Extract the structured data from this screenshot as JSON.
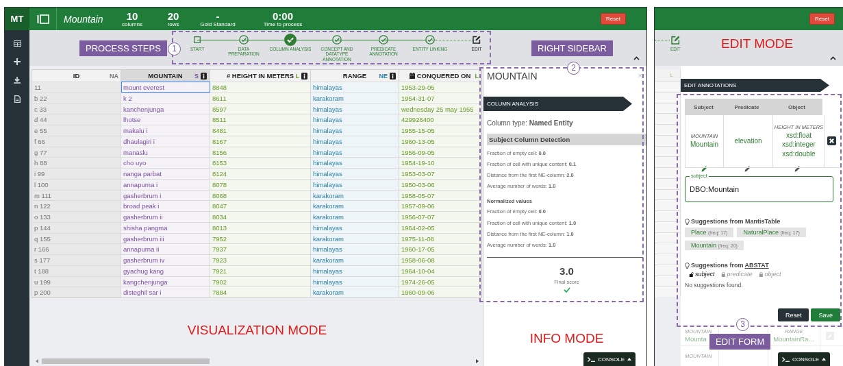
{
  "main_screen": {
    "header": {
      "logo": "MT",
      "table_name": "Mountain",
      "stats": [
        {
          "value": "10",
          "label": "columns"
        },
        {
          "value": "20",
          "label": "rows"
        },
        {
          "value": "-",
          "label": "Gold Standard"
        },
        {
          "value": "0:00",
          "label": "Time to process"
        }
      ],
      "reset_button": "Reset"
    },
    "process_steps": [
      {
        "label": "START",
        "kind": "start",
        "selected": false
      },
      {
        "label": "DATA PREPARATION",
        "kind": "check",
        "selected": false
      },
      {
        "label": "COLUMN ANALYSIS",
        "kind": "check",
        "selected": true
      },
      {
        "label": "CONCEPT AND DATATYPE ANNOTATION",
        "kind": "check",
        "selected": false
      },
      {
        "label": "PREDICATE ANNOTATION",
        "kind": "check",
        "selected": false
      },
      {
        "label": "ENTITY LINKING",
        "kind": "check",
        "selected": false
      },
      {
        "label": "EDIT",
        "kind": "edit",
        "selected": false
      }
    ],
    "table": {
      "columns": [
        {
          "name": "ID",
          "tag": "NA",
          "color": "#757575",
          "selected": false,
          "info": false,
          "kind": "text"
        },
        {
          "name": "MOUNTAIN",
          "tag": "S",
          "color": "#7b4fa0",
          "selected": true,
          "info": true,
          "kind": "text"
        },
        {
          "name": "# HEIGHT IN METERS",
          "tag": "L",
          "color": "#6a9a2a",
          "selected": false,
          "info": true,
          "kind": "text"
        },
        {
          "name": "RANGE",
          "tag": "NE",
          "color": "#2a7fa8",
          "selected": false,
          "info": true,
          "kind": "text"
        },
        {
          "name": "CONQUERED ON",
          "tag": "L",
          "color": "#6a9a2a",
          "selected": false,
          "info": false,
          "kind": "date"
        }
      ],
      "rows": [
        {
          "cells": [
            "11",
            "mount everest",
            "8848",
            "himalayas",
            "1953-29-05"
          ],
          "selected": true
        },
        {
          "cells": [
            "b 22",
            "k 2",
            "8611",
            "karakoram",
            "1954-31-07"
          ],
          "selected": false
        },
        {
          "cells": [
            "c 33",
            "kanchenjunga",
            "8597",
            "himalayas",
            "wednesday 25 may 1955"
          ],
          "selected": false
        },
        {
          "cells": [
            "d 44",
            "lhotse",
            "8511",
            "himalayas",
            "429926400"
          ],
          "selected": false
        },
        {
          "cells": [
            "e 55",
            "makalu i",
            "8481",
            "himalayas",
            "1955-15-05"
          ],
          "selected": false
        },
        {
          "cells": [
            "f 66",
            "dhaulagiri i",
            "8167",
            "himalayas",
            "1960-13-05"
          ],
          "selected": false
        },
        {
          "cells": [
            "g 77",
            "manaslu",
            "8156",
            "himalayas",
            "1956-09-05"
          ],
          "selected": false
        },
        {
          "cells": [
            "h 88",
            "cho uyo",
            "8153",
            "himalayas",
            "1954-19-10"
          ],
          "selected": false
        },
        {
          "cells": [
            "i 99",
            "nanga parbat",
            "8124",
            "himalayas",
            "1953-03-07"
          ],
          "selected": false
        },
        {
          "cells": [
            "l 100",
            "annapurna i",
            "8078",
            "himalayas",
            "1950-03-06"
          ],
          "selected": false
        },
        {
          "cells": [
            "m 111",
            "gasherbrum i",
            "8068",
            "karakoram",
            "1958-05-07"
          ],
          "selected": false
        },
        {
          "cells": [
            "n 122",
            "broad peak i",
            "8047",
            "karakoram",
            "1957-09-06"
          ],
          "selected": false
        },
        {
          "cells": [
            "o 133",
            "gasherbrum ii",
            "8034",
            "karakoram",
            "1956-07-07"
          ],
          "selected": false
        },
        {
          "cells": [
            "p 144",
            "shisha pangma",
            "8013",
            "himalayas",
            "1964-02-05"
          ],
          "selected": false
        },
        {
          "cells": [
            "q 155",
            "gasherbrum iii",
            "7952",
            "karakoram",
            "1975-11-08"
          ],
          "selected": false
        },
        {
          "cells": [
            "r 166",
            "annapurna ii",
            "7937",
            "himalayas",
            "1960-17-05"
          ],
          "selected": false
        },
        {
          "cells": [
            "s 177",
            "gasherbrum iv",
            "7923",
            "karakoram",
            "1958-06-08"
          ],
          "selected": false
        },
        {
          "cells": [
            "t 188",
            "gyachug kang",
            "7921",
            "himalayas",
            "1964-10-04"
          ],
          "selected": false
        },
        {
          "cells": [
            "u 199",
            "kangchenjunga",
            "7902",
            "himalayas",
            "1974-26-05"
          ],
          "selected": false
        },
        {
          "cells": [
            "p 200",
            "disteghil sar i",
            "7884",
            "karakoram",
            "1960-09-06"
          ],
          "selected": false
        }
      ]
    },
    "sidebar": {
      "title": "MOUNTAIN",
      "close": "×",
      "banner": "COLUMN ANALYSIS",
      "column_type": "Column type: **Named Entity**",
      "section": "Subject Column Detection",
      "metrics": [
        "Fraction of empty cell: **0.0**",
        "Fraction of cell with unique content: **0.1**",
        "Distance from the first NE-column: **2.0**",
        "Average number of words: **1.0**"
      ],
      "normalized_heading": "Normalized values",
      "normalized": [
        "Fraction of empty cell: **0.0**",
        "Fraction of cell with unique content: **1.0**",
        "Distance from the first NE-column: **1.0**",
        "Average number of words: **1.0**"
      ],
      "score": "3.0",
      "score_label": "Final score"
    },
    "console": "CONSOLE",
    "callouts": {
      "steps_label": "PROCESS STEPS",
      "steps_number": "1",
      "sidebar_label": "RIGHT SIDEBAR",
      "sidebar_number": "2",
      "visualization_mode": "VISUALIZATION MODE",
      "info_mode": "INFO MODE"
    }
  },
  "edit_screen": {
    "reset_button": "Reset",
    "step_label": "EDIT",
    "mode_label": "EDIT MODE",
    "strip_header": "L",
    "banner": "EDIT ANNOTATIONS",
    "triple": [
      {
        "header": "Subject",
        "type": "MOUNTAIN",
        "values": [
          "Mountain"
        ],
        "selected": true
      },
      {
        "header": "Predicate",
        "values": [
          "elevation"
        ],
        "selected": false
      },
      {
        "header": "Object",
        "type": "HEIGHT IN METERS",
        "values": [
          "xsd:float",
          "xsd:integer",
          "xsd:double"
        ],
        "selected": false
      }
    ],
    "field": {
      "label": "subject",
      "value": "DBO:Mountain"
    },
    "mantis": {
      "heading": "Suggestions from MantisTable",
      "chips": [
        {
          "name": "Place",
          "freq": "(freq: 17)"
        },
        {
          "name": "NaturalPlace",
          "freq": "(freq: 17)"
        },
        {
          "name": "Mountain",
          "freq": "(freq: 20)"
        }
      ]
    },
    "abstat": {
      "heading": "Suggestions from",
      "link": "ABSTAT",
      "filters": [
        {
          "label": "subject",
          "locked": false
        },
        {
          "label": "predicate",
          "locked": true
        },
        {
          "label": "object",
          "locked": true
        }
      ],
      "message": "No suggestions found."
    },
    "buttons": [
      {
        "label": "Reset",
        "kind": "secondary"
      },
      {
        "label": "Save",
        "kind": "primary"
      }
    ],
    "faded_rows": [
      {
        "subject_type": "MOUNTAIN",
        "subject": "Mounta",
        "object_type": "RANGE",
        "object": "MountainRa…"
      },
      {
        "subject_type": "MOUNTAIN"
      }
    ],
    "form_label": "EDIT FORM",
    "form_number": "3",
    "console": "CONSOLE"
  }
}
